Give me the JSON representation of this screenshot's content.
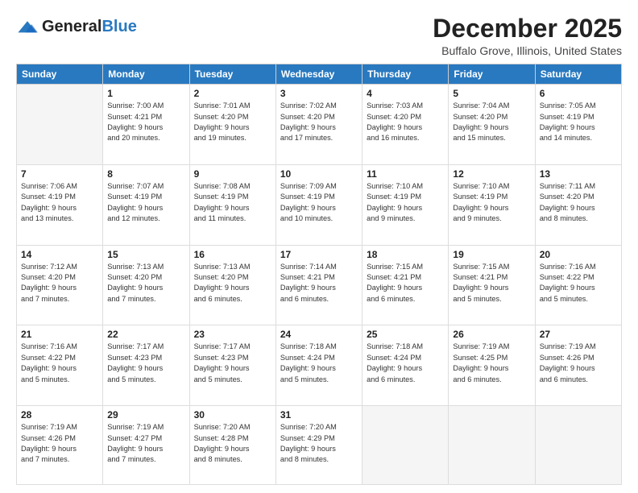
{
  "logo": {
    "general": "General",
    "blue": "Blue"
  },
  "title": "December 2025",
  "location": "Buffalo Grove, Illinois, United States",
  "days_header": [
    "Sunday",
    "Monday",
    "Tuesday",
    "Wednesday",
    "Thursday",
    "Friday",
    "Saturday"
  ],
  "weeks": [
    [
      {
        "day": "",
        "info": ""
      },
      {
        "day": "1",
        "info": "Sunrise: 7:00 AM\nSunset: 4:21 PM\nDaylight: 9 hours\nand 20 minutes."
      },
      {
        "day": "2",
        "info": "Sunrise: 7:01 AM\nSunset: 4:20 PM\nDaylight: 9 hours\nand 19 minutes."
      },
      {
        "day": "3",
        "info": "Sunrise: 7:02 AM\nSunset: 4:20 PM\nDaylight: 9 hours\nand 17 minutes."
      },
      {
        "day": "4",
        "info": "Sunrise: 7:03 AM\nSunset: 4:20 PM\nDaylight: 9 hours\nand 16 minutes."
      },
      {
        "day": "5",
        "info": "Sunrise: 7:04 AM\nSunset: 4:20 PM\nDaylight: 9 hours\nand 15 minutes."
      },
      {
        "day": "6",
        "info": "Sunrise: 7:05 AM\nSunset: 4:19 PM\nDaylight: 9 hours\nand 14 minutes."
      }
    ],
    [
      {
        "day": "7",
        "info": "Sunrise: 7:06 AM\nSunset: 4:19 PM\nDaylight: 9 hours\nand 13 minutes."
      },
      {
        "day": "8",
        "info": "Sunrise: 7:07 AM\nSunset: 4:19 PM\nDaylight: 9 hours\nand 12 minutes."
      },
      {
        "day": "9",
        "info": "Sunrise: 7:08 AM\nSunset: 4:19 PM\nDaylight: 9 hours\nand 11 minutes."
      },
      {
        "day": "10",
        "info": "Sunrise: 7:09 AM\nSunset: 4:19 PM\nDaylight: 9 hours\nand 10 minutes."
      },
      {
        "day": "11",
        "info": "Sunrise: 7:10 AM\nSunset: 4:19 PM\nDaylight: 9 hours\nand 9 minutes."
      },
      {
        "day": "12",
        "info": "Sunrise: 7:10 AM\nSunset: 4:19 PM\nDaylight: 9 hours\nand 9 minutes."
      },
      {
        "day": "13",
        "info": "Sunrise: 7:11 AM\nSunset: 4:20 PM\nDaylight: 9 hours\nand 8 minutes."
      }
    ],
    [
      {
        "day": "14",
        "info": "Sunrise: 7:12 AM\nSunset: 4:20 PM\nDaylight: 9 hours\nand 7 minutes."
      },
      {
        "day": "15",
        "info": "Sunrise: 7:13 AM\nSunset: 4:20 PM\nDaylight: 9 hours\nand 7 minutes."
      },
      {
        "day": "16",
        "info": "Sunrise: 7:13 AM\nSunset: 4:20 PM\nDaylight: 9 hours\nand 6 minutes."
      },
      {
        "day": "17",
        "info": "Sunrise: 7:14 AM\nSunset: 4:21 PM\nDaylight: 9 hours\nand 6 minutes."
      },
      {
        "day": "18",
        "info": "Sunrise: 7:15 AM\nSunset: 4:21 PM\nDaylight: 9 hours\nand 6 minutes."
      },
      {
        "day": "19",
        "info": "Sunrise: 7:15 AM\nSunset: 4:21 PM\nDaylight: 9 hours\nand 5 minutes."
      },
      {
        "day": "20",
        "info": "Sunrise: 7:16 AM\nSunset: 4:22 PM\nDaylight: 9 hours\nand 5 minutes."
      }
    ],
    [
      {
        "day": "21",
        "info": "Sunrise: 7:16 AM\nSunset: 4:22 PM\nDaylight: 9 hours\nand 5 minutes."
      },
      {
        "day": "22",
        "info": "Sunrise: 7:17 AM\nSunset: 4:23 PM\nDaylight: 9 hours\nand 5 minutes."
      },
      {
        "day": "23",
        "info": "Sunrise: 7:17 AM\nSunset: 4:23 PM\nDaylight: 9 hours\nand 5 minutes."
      },
      {
        "day": "24",
        "info": "Sunrise: 7:18 AM\nSunset: 4:24 PM\nDaylight: 9 hours\nand 5 minutes."
      },
      {
        "day": "25",
        "info": "Sunrise: 7:18 AM\nSunset: 4:24 PM\nDaylight: 9 hours\nand 6 minutes."
      },
      {
        "day": "26",
        "info": "Sunrise: 7:19 AM\nSunset: 4:25 PM\nDaylight: 9 hours\nand 6 minutes."
      },
      {
        "day": "27",
        "info": "Sunrise: 7:19 AM\nSunset: 4:26 PM\nDaylight: 9 hours\nand 6 minutes."
      }
    ],
    [
      {
        "day": "28",
        "info": "Sunrise: 7:19 AM\nSunset: 4:26 PM\nDaylight: 9 hours\nand 7 minutes."
      },
      {
        "day": "29",
        "info": "Sunrise: 7:19 AM\nSunset: 4:27 PM\nDaylight: 9 hours\nand 7 minutes."
      },
      {
        "day": "30",
        "info": "Sunrise: 7:20 AM\nSunset: 4:28 PM\nDaylight: 9 hours\nand 8 minutes."
      },
      {
        "day": "31",
        "info": "Sunrise: 7:20 AM\nSunset: 4:29 PM\nDaylight: 9 hours\nand 8 minutes."
      },
      {
        "day": "",
        "info": ""
      },
      {
        "day": "",
        "info": ""
      },
      {
        "day": "",
        "info": ""
      }
    ]
  ]
}
